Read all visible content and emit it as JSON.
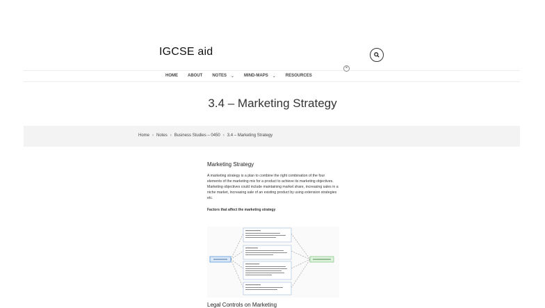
{
  "site": {
    "title": "IGCSE aid"
  },
  "header": {
    "search_icon": "search-icon",
    "close_icon": "close-icon",
    "close_glyph": "×"
  },
  "nav": [
    {
      "label": "HOME",
      "has_dropdown": false
    },
    {
      "label": "ABOUT",
      "has_dropdown": false
    },
    {
      "label": "NOTES",
      "has_dropdown": true
    },
    {
      "label": "MIND-MAPS",
      "has_dropdown": true
    },
    {
      "label": "RESOURCES",
      "has_dropdown": false
    }
  ],
  "page": {
    "title": "3.4 – Marketing Strategy"
  },
  "breadcrumb": [
    "Home",
    "Notes",
    "Business Studies – 0450",
    "3.4 – Marketing Strategy"
  ],
  "article": {
    "section_heading": "Marketing Strategy",
    "paragraph": "A marketing strategy is a plan to combine the right combination of the four elements of the marketing mix for a product to achieve its marketing objectives. Marketing objectives could include maintaining market share, increasing sales in a niche market, increasing sale of an existing product by using extension strategies etc.",
    "factors_heading": "Factors that affect the marketing strategy",
    "next_heading": "Legal Controls on Marketing"
  },
  "colors": {
    "accent_blue": "#4a90d9",
    "accent_green": "#7cc47a",
    "breadcrumb_bg": "#f3f3f3"
  }
}
